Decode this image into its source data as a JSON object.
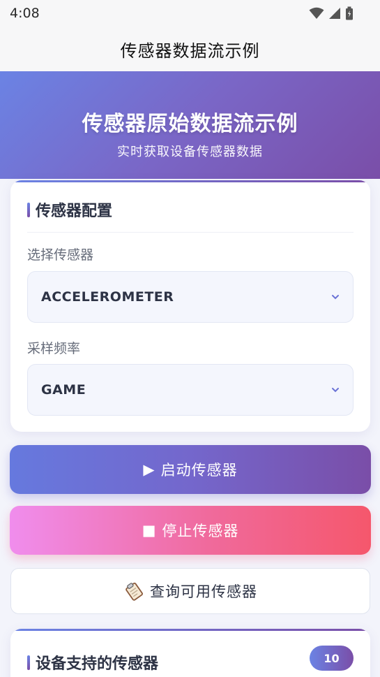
{
  "status_bar": {
    "time": "4:08",
    "icons": [
      "wifi-icon",
      "signal-icon",
      "battery-icon"
    ]
  },
  "app_bar": {
    "title": "传感器数据流示例"
  },
  "hero": {
    "title": "传感器原始数据流示例",
    "subtitle": "实时获取设备传感器数据"
  },
  "config": {
    "section_title": "传感器配置",
    "sensor_label": "选择传感器",
    "sensor_value": "ACCELEROMETER",
    "rate_label": "采样频率",
    "rate_value": "GAME"
  },
  "buttons": {
    "start_icon": "▶",
    "start_label": "启动传感器",
    "stop_icon": "■",
    "stop_label": "停止传感器",
    "query_icon": "clipboard-icon",
    "query_label": "查询可用传感器"
  },
  "supported": {
    "section_title": "设备支持的传感器",
    "count": "10"
  },
  "colors": {
    "accent_start": "#6b83e4",
    "accent_end": "#7a4ea8",
    "stop_start": "#f08ded",
    "stop_end": "#f5576c"
  }
}
